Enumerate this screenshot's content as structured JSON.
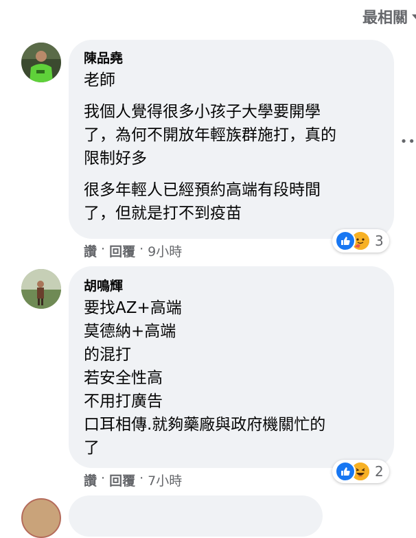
{
  "sort": {
    "label": "最相關"
  },
  "comments": [
    {
      "author": "陳品堯",
      "paragraphs": [
        "老師",
        "我個人覺得很多小孩子大學要開學\n了，為何不開放年輕族群施打，真的\n限制好多",
        "很多年輕人已經預約高端有段時間\n了，但就是打不到疫苗"
      ],
      "actions": {
        "like": "讚",
        "reply": "回覆",
        "time": "9小時"
      },
      "reactions": {
        "icons": [
          "like-icon",
          "care-icon"
        ],
        "count": "3"
      }
    },
    {
      "author": "胡鳴輝",
      "body": "要找AZ+高端\n莫德納+高端\n的混打\n若安全性高\n不用打廣告\n口耳相傳.就夠藥廠與政府機關忙的\n了",
      "actions": {
        "like": "讚",
        "reply": "回覆",
        "time": "7小時"
      },
      "reactions": {
        "icons": [
          "like-icon",
          "haha-icon"
        ],
        "count": "2"
      }
    }
  ],
  "colors": {
    "bubble": "#f0f2f5",
    "meta": "#65676b",
    "like": "#1877f2",
    "emoji": "#f7b125"
  }
}
